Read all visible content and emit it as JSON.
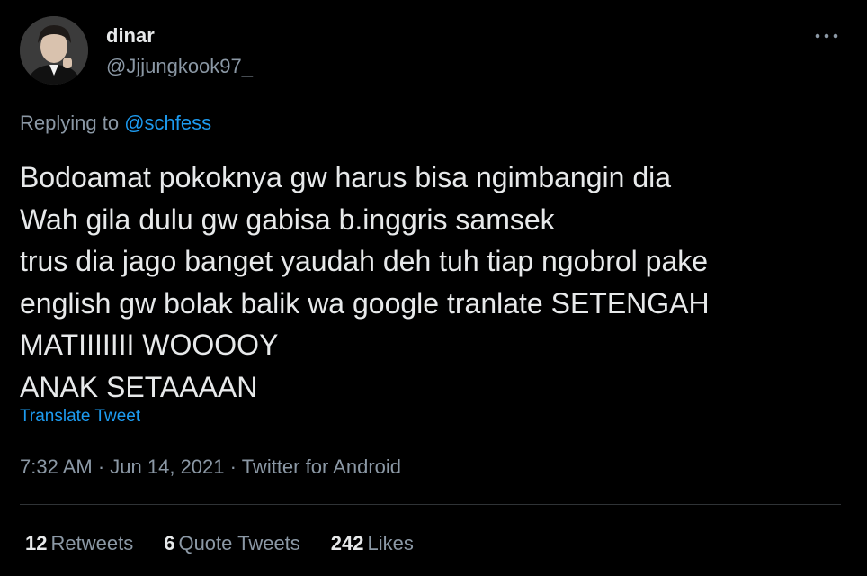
{
  "user": {
    "display_name": "dinar",
    "handle": "@Jjjungkook97_"
  },
  "reply": {
    "prefix": "Replying to",
    "mention": "@schfess"
  },
  "tweet": {
    "lines": [
      "Bodoamat pokoknya gw harus bisa ngimbangin dia",
      "Wah gila dulu gw gabisa b.inggris samsek",
      "trus dia jago banget yaudah deh tuh tiap ngobrol pake",
      "english gw bolak balik wa google tranlate SETENGAH",
      "MATIIIIIII WOOOOY",
      "ANAK SETAAAAN"
    ],
    "translate_label": "Translate Tweet"
  },
  "meta": {
    "time": "7:32 AM",
    "separator": "·",
    "date": "Jun 14, 2021",
    "source": "Twitter for Android"
  },
  "stats": {
    "retweets_count": "12",
    "retweets_label": "Retweets",
    "quotes_count": "6",
    "quotes_label": "Quote Tweets",
    "likes_count": "242",
    "likes_label": "Likes"
  },
  "icons": {
    "more": "more-icon",
    "avatar": "avatar"
  },
  "colors": {
    "background": "#000000",
    "text": "#e7e9ea",
    "secondary": "#8b98a5",
    "accent": "#1d9bf0",
    "divider": "#2f3336"
  }
}
